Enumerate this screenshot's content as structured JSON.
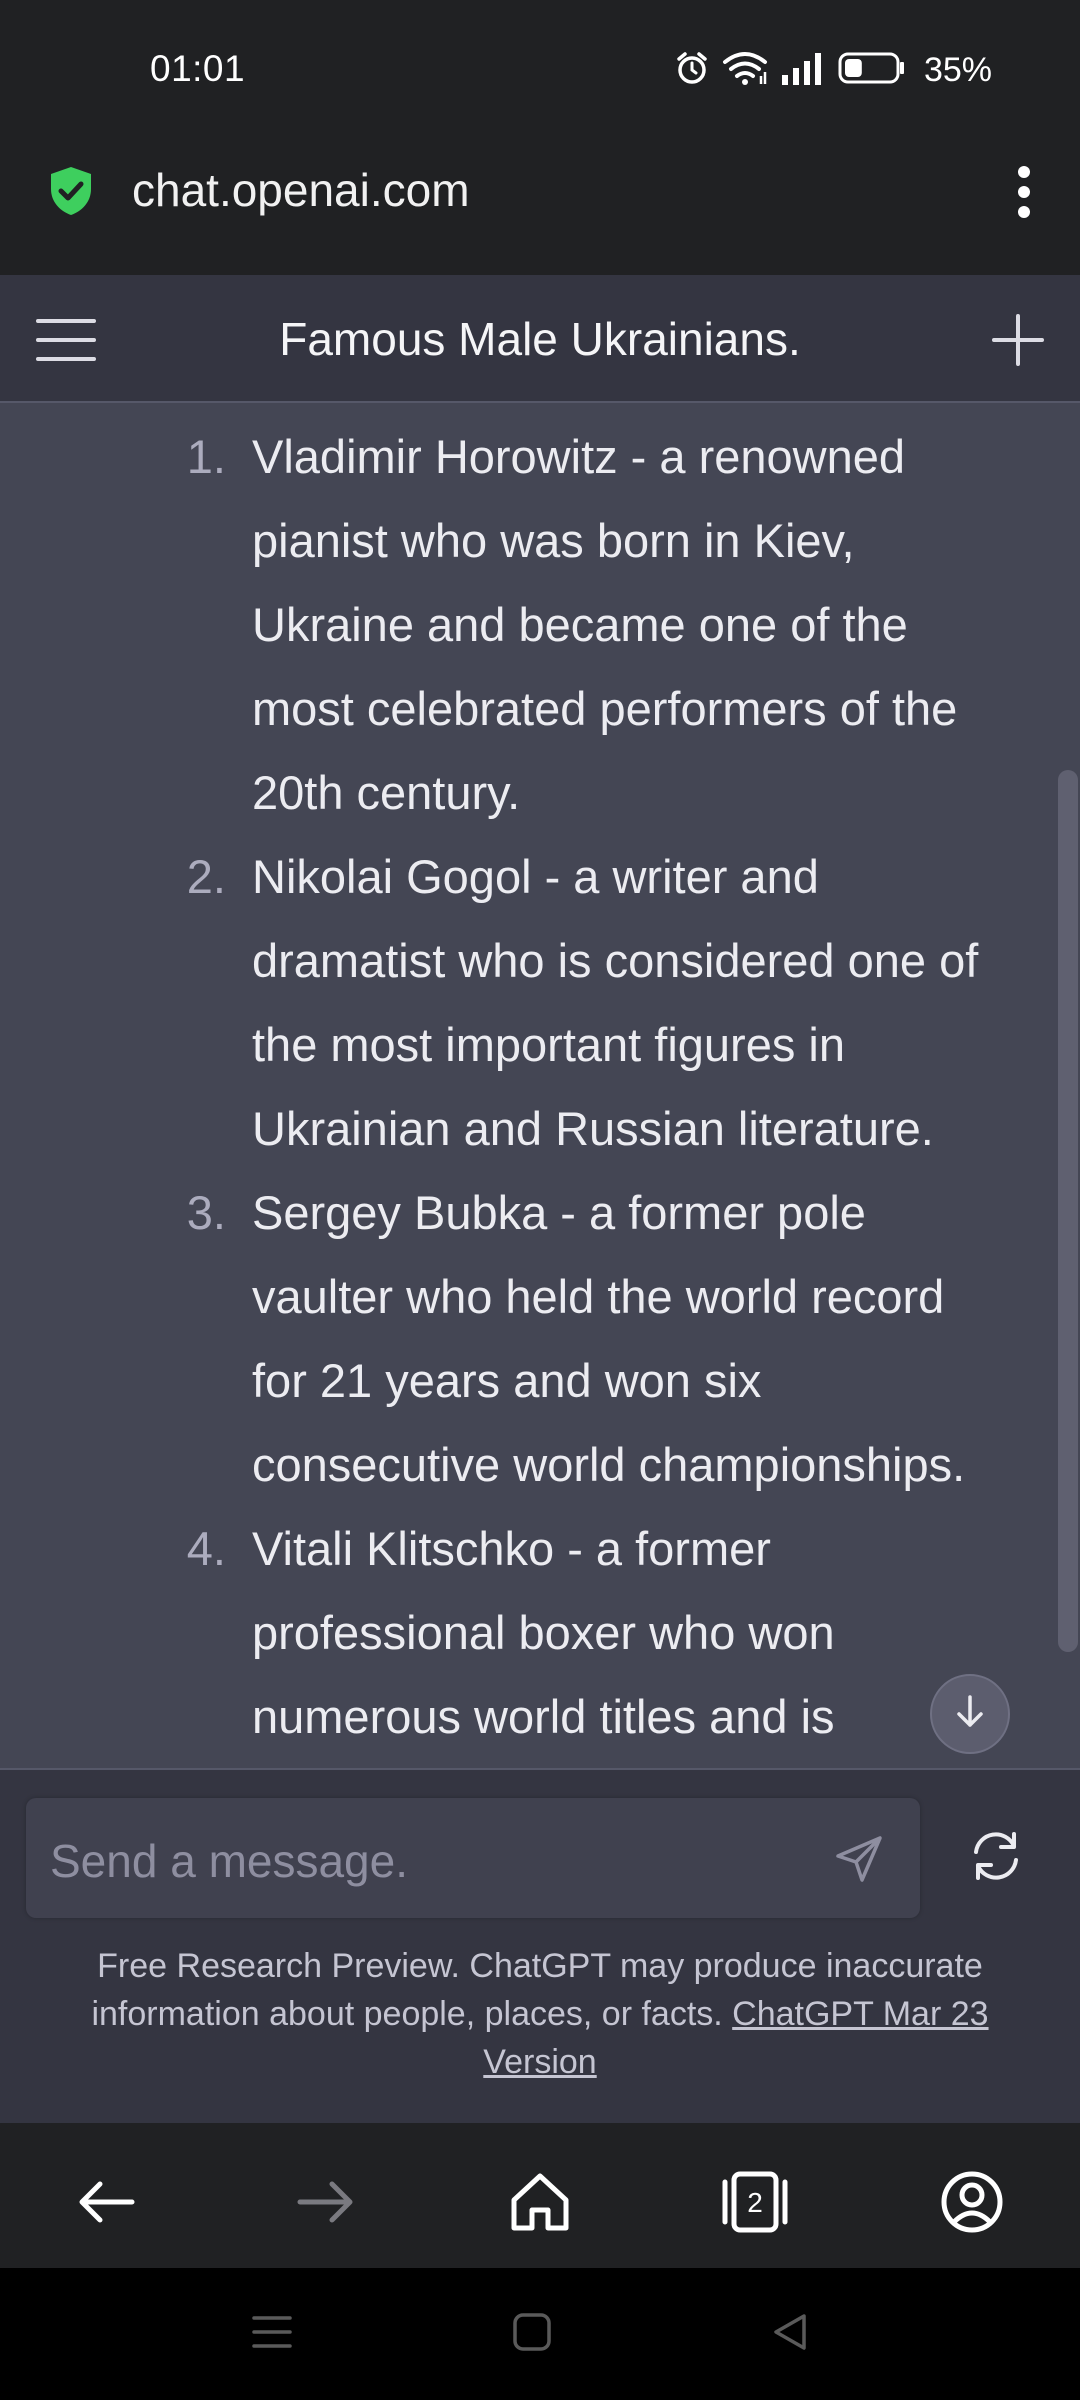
{
  "status_bar": {
    "time": "01:01",
    "battery_percent": "35%",
    "battery_level": 0.35,
    "icons": [
      "alarm-icon",
      "wifi-icon",
      "signal-icon",
      "battery-icon"
    ]
  },
  "browser": {
    "url": "chat.openai.com",
    "tab_count": "2"
  },
  "chat": {
    "title": "Famous Male Ukrainians.",
    "items": [
      {
        "number": "1.",
        "text": "Vladimir Horowitz - a renowned pianist who was born in Kiev, Ukraine and became one of the most celebrated performers of the 20th century."
      },
      {
        "number": "2.",
        "text": "Nikolai Gogol - a writer and dramatist who is considered one of the most important figures in Ukrainian and Russian literature."
      },
      {
        "number": "3.",
        "text": "Sergey Bubka - a former pole vaulter who held the world record for 21 years and won six consecutive world championships."
      },
      {
        "number": "4.",
        "text": "Vitali Klitschko - a former professional boxer who won numerous world titles and is"
      }
    ]
  },
  "composer": {
    "placeholder": "Send a message."
  },
  "disclaimer": {
    "text": "Free Research Preview. ChatGPT may produce inaccurate information about people, places, or facts.",
    "link": "ChatGPT Mar 23 Version"
  },
  "colors": {
    "chat_bg": "#444654",
    "header_bg": "#343541",
    "chrome_bg": "#202123",
    "shield_green": "#3ecf5e"
  }
}
